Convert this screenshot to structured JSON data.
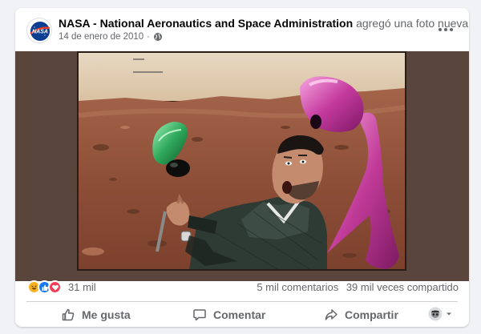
{
  "post": {
    "page_name": "NASA - National Aeronautics and Space Administration",
    "action": "agregó una foto nueva.",
    "date": "14 de enero de 2010",
    "privacy_icon": "globe-icon",
    "avatar_logo_text": "NASA"
  },
  "stats": {
    "reaction_icons": [
      "haha-icon",
      "like-icon",
      "love-icon"
    ],
    "reactions_count": "31 mil",
    "comments": "5 mil comentarios",
    "shares": "39 mil veces compartido"
  },
  "actions": {
    "like": "Me gusta",
    "comment": "Comentar",
    "share": "Compartir"
  },
  "colors": {
    "brand_blue": "#1877f2",
    "text_primary": "#050505",
    "text_secondary": "#65676b",
    "photo_letterbox": "#5a453d"
  }
}
